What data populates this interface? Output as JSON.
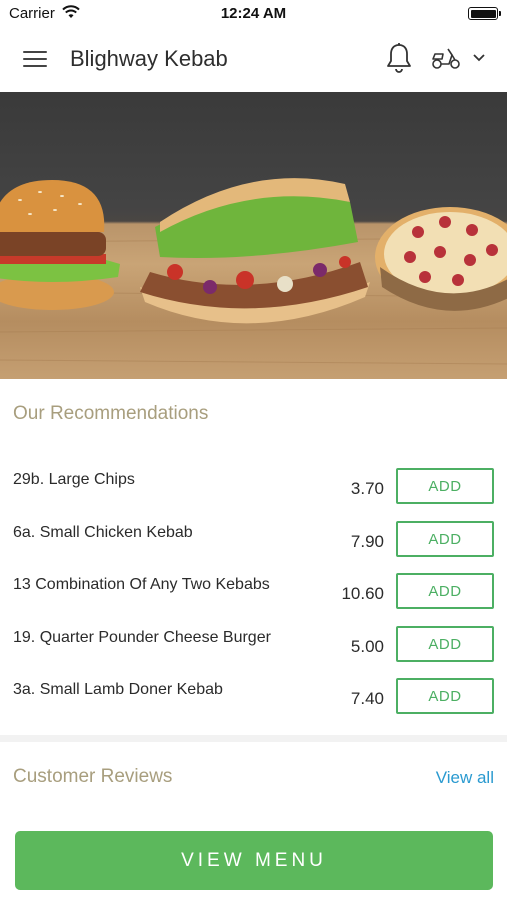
{
  "status_bar": {
    "carrier": "Carrier",
    "time": "12:24 AM"
  },
  "header": {
    "title": "Blighway Kebab",
    "icons": [
      "menu-icon",
      "bell-icon",
      "scooter-icon",
      "chevron-down-icon"
    ]
  },
  "recommendations": {
    "title": "Our Recommendations",
    "items": [
      {
        "name": "29b. Large Chips",
        "price": "3.70",
        "add_label": "ADD"
      },
      {
        "name": "6a. Small Chicken Kebab",
        "price": "7.90",
        "add_label": "ADD"
      },
      {
        "name": "13 Combination Of Any Two Kebabs",
        "price": "10.60",
        "add_label": "ADD"
      },
      {
        "name": "19. Quarter Pounder Cheese Burger",
        "price": "5.00",
        "add_label": "ADD"
      },
      {
        "name": "3a. Small Lamb Doner Kebab",
        "price": "7.40",
        "add_label": "ADD"
      }
    ]
  },
  "reviews": {
    "title": "Customer Reviews",
    "view_all_label": "View all"
  },
  "footer": {
    "view_menu_label": "VIEW MENU"
  },
  "colors": {
    "accent_green": "#4caf63",
    "button_green": "#5cb85c",
    "link_blue": "#2a9ad0",
    "section_title": "#a89e7e"
  }
}
